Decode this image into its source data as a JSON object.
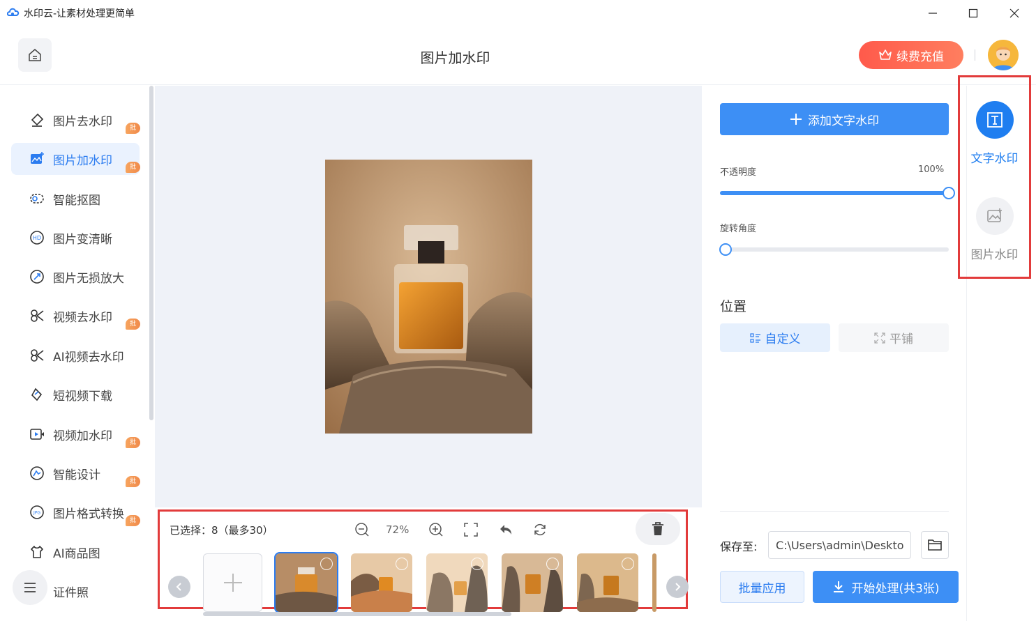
{
  "window": {
    "title": "水印云-让素材处理更简单"
  },
  "header": {
    "title": "图片加水印",
    "vip_label": "续费充值"
  },
  "sidebar": {
    "items": [
      {
        "label": "图片去水印",
        "badge": "批量"
      },
      {
        "label": "图片加水印",
        "badge": "批量"
      },
      {
        "label": "智能抠图",
        "badge": ""
      },
      {
        "label": "图片变清晰",
        "badge": ""
      },
      {
        "label": "图片无损放大",
        "badge": ""
      },
      {
        "label": "视频去水印",
        "badge": "批量"
      },
      {
        "label": "AI视频去水印",
        "badge": ""
      },
      {
        "label": "短视频下载",
        "badge": ""
      },
      {
        "label": "视频加水印",
        "badge": "批量"
      },
      {
        "label": "智能设计",
        "badge": "批量"
      },
      {
        "label": "图片格式转换",
        "badge": "批量"
      },
      {
        "label": "AI商品图",
        "badge": ""
      },
      {
        "label": "证件照",
        "badge": ""
      }
    ],
    "active_index": 1
  },
  "toolbar": {
    "selected_text": "已选择：8（最多30）",
    "zoom": "72%"
  },
  "panel": {
    "add_text_label": "添加文字水印",
    "opacity_label": "不透明度",
    "opacity_value": "100%",
    "opacity_fraction": 1.0,
    "rotation_label": "旋转角度",
    "rotation_fraction": 0.0,
    "position_title": "位置",
    "custom_label": "自定义",
    "tile_label": "平铺",
    "save_label": "保存至:",
    "save_path": "C:\\Users\\admin\\Desktop",
    "batch_label": "批量应用",
    "start_label": "开始处理(共3张)"
  },
  "rail": {
    "text_watermark": "文字水印",
    "image_watermark": "图片水印"
  },
  "colors": {
    "accent": "#3d8ff5",
    "highlight_border": "#e23b3b",
    "badge": "#f08a4b"
  }
}
